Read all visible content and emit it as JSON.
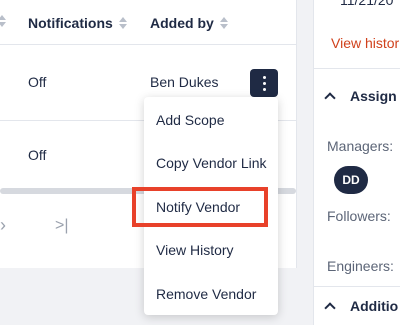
{
  "table": {
    "columns": [
      {
        "label": "Notifications"
      },
      {
        "label": "Added by"
      }
    ],
    "rows": [
      {
        "notifications": "Off",
        "added_by": "Ben Dukes"
      },
      {
        "notifications": "Off",
        "added_by": ""
      }
    ],
    "pager": {
      "next_icon": "chevron-right-icon",
      "last_icon": "last-page-icon",
      "next_glyph": "›",
      "last_glyph": ">|"
    }
  },
  "row_actions_icon": "more-vertical-icon",
  "menu": {
    "items": [
      {
        "label": "Add Scope"
      },
      {
        "label": "Copy Vendor Link"
      },
      {
        "label": "Notify Vendor",
        "highlighted": true
      },
      {
        "label": "View History"
      },
      {
        "label": "Remove Vendor"
      }
    ]
  },
  "right_panel": {
    "date_text": "11/21/20",
    "view_history_link": "View histor",
    "sections": [
      {
        "title": "Assign T"
      },
      {
        "title": "Additio"
      }
    ],
    "fields": {
      "managers_label": "Managers:",
      "manager_avatar_initials": "DD",
      "followers_label": "Followers:",
      "engineers_label": "Engineers:"
    }
  },
  "colors": {
    "accent_navy": "#1f2a44",
    "link_red": "#d0411c",
    "highlight_red": "#e8412a"
  }
}
